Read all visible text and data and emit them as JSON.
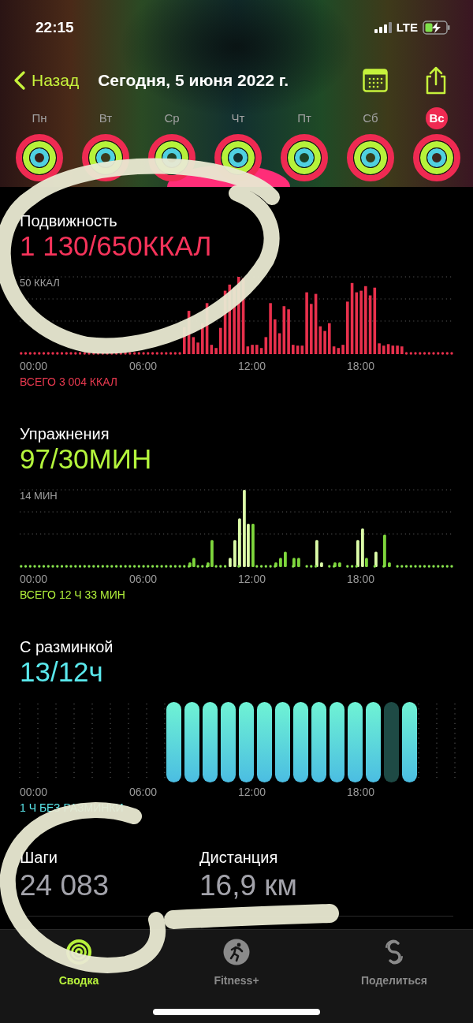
{
  "status_bar": {
    "time": "22:15",
    "network": "LTE"
  },
  "nav": {
    "back": "Назад",
    "title": "Сегодня, 5 июня 2022 г."
  },
  "days": [
    {
      "label": "Пн",
      "selected": false
    },
    {
      "label": "Вт",
      "selected": false
    },
    {
      "label": "Ср",
      "selected": false
    },
    {
      "label": "Чт",
      "selected": false
    },
    {
      "label": "Пт",
      "selected": false
    },
    {
      "label": "Сб",
      "selected": false
    },
    {
      "label": "Вс",
      "selected": true
    }
  ],
  "metrics": [
    {
      "kind": "move",
      "title": "Подвижность",
      "value": "1 130/650ККАЛ",
      "scale": "50 ККАЛ",
      "x_labels": [
        "00:00",
        "06:00",
        "12:00",
        "18:00"
      ],
      "total": "ВСЕГО 3 004 ККАЛ"
    },
    {
      "kind": "exercise",
      "title": "Упражнения",
      "value": "97/30МИН",
      "scale": "14 МИН",
      "x_labels": [
        "00:00",
        "06:00",
        "12:00",
        "18:00"
      ],
      "total": "ВСЕГО 12 Ч 33 МИН"
    },
    {
      "kind": "stand",
      "title": "С разминкой",
      "value": "13/12ч",
      "x_labels": [
        "00:00",
        "06:00",
        "12:00",
        "18:00"
      ],
      "total": "1 Ч БЕЗ РАЗМИНКИ"
    }
  ],
  "stats": [
    {
      "label": "Шаги",
      "value": "24 083"
    },
    {
      "label": "Дистанция",
      "value": "16,9 км"
    }
  ],
  "tabs": [
    {
      "kind": "summary",
      "label": "Сводка",
      "selected": true
    },
    {
      "kind": "fitness",
      "label": "Fitness+",
      "selected": false
    },
    {
      "kind": "sharing",
      "label": "Поделиться",
      "selected": false
    }
  ]
}
